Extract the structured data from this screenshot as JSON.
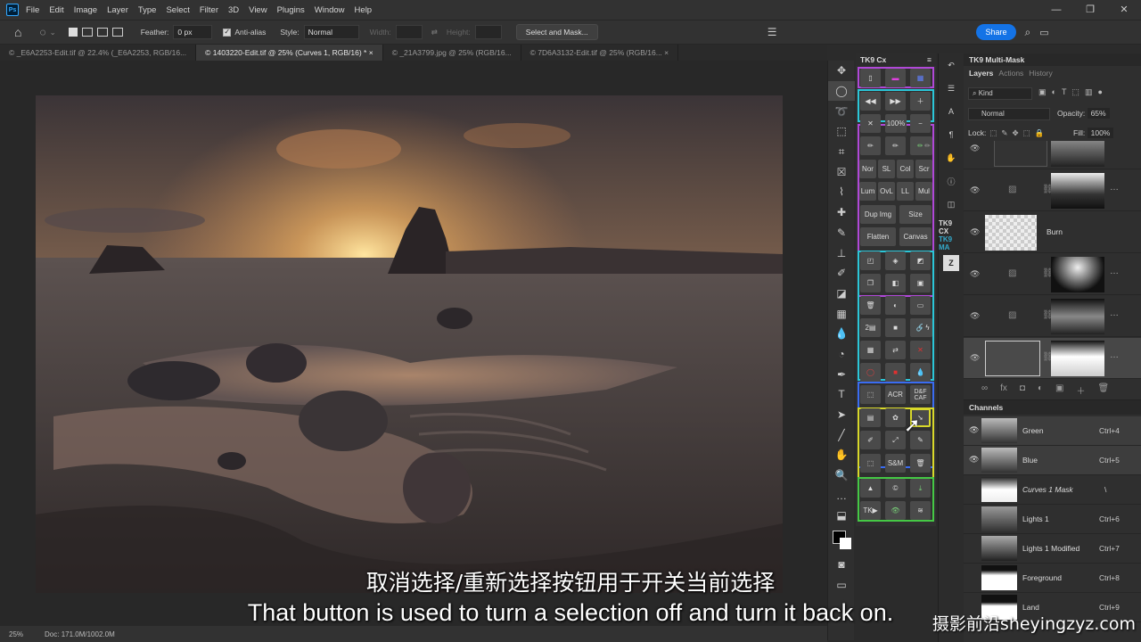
{
  "menu": [
    "File",
    "Edit",
    "Image",
    "Layer",
    "Type",
    "Select",
    "Filter",
    "3D",
    "View",
    "Plugins",
    "Window",
    "Help"
  ],
  "app_icon": "Ps",
  "window_controls": [
    "—",
    "❐",
    "✕"
  ],
  "options": {
    "feather_label": "Feather:",
    "feather_value": "0 px",
    "antialias_label": "Anti-alias",
    "style_label": "Style:",
    "style_value": "Normal",
    "width_label": "Width:",
    "height_label": "Height:",
    "select_mask": "Select and Mask...",
    "share": "Share"
  },
  "tabs": [
    "© _E6A2253-Edit.tif @ 22.4% (_E6A2253, RGB/16...",
    "© 1403220-Edit.tif @ 25% (Curves 1, RGB/16) *  ×",
    "© _21A3799.jpg @ 25% (RGB/16...",
    "© 7D6A3132-Edit.tif @ 25% (RGB/16...  ×"
  ],
  "status": {
    "zoom": "25%",
    "doc": "Doc: 171.0M/1002.0M"
  },
  "tk9": {
    "title": "TK9 Cx",
    "zoom_label": "100%",
    "blend_row1": [
      "Nor",
      "SL",
      "Col",
      "Scr"
    ],
    "blend_row2": [
      "Lum",
      "OvL",
      "LL",
      "Mul"
    ],
    "dup": "Dup Img",
    "size": "Size",
    "flatten": "Flatten",
    "canvas": "Canvas",
    "acr": "ACR",
    "dcaf": "D&F CAF",
    "sm": "S&M",
    "tk": "TK▶"
  },
  "strip_logos": [
    "TK9 CX",
    "TK9 MA"
  ],
  "layers_panel": {
    "title": "TK9 Multi-Mask",
    "tabs": [
      "Layers",
      "Actions",
      "History"
    ],
    "kind": "Kind",
    "blend": "Normal",
    "opacity_label": "Opacity:",
    "opacity": "65%",
    "lock_label": "Lock:",
    "fill_label": "Fill:",
    "fill": "100%",
    "burn": "Burn",
    "bottom_icons": [
      "∞",
      "fx",
      "◘",
      "◐",
      "▣",
      "＋",
      "🗑"
    ]
  },
  "channels": {
    "title": "Channels",
    "rows": [
      {
        "name": "Green",
        "key": "Ctrl+4"
      },
      {
        "name": "Blue",
        "key": "Ctrl+5"
      },
      {
        "name": "Curves 1 Mask",
        "key": "\\"
      },
      {
        "name": "Lights 1",
        "key": "Ctrl+6"
      },
      {
        "name": "Lights 1 Modified",
        "key": "Ctrl+7"
      },
      {
        "name": "Foreground",
        "key": "Ctrl+8"
      },
      {
        "name": "Land",
        "key": "Ctrl+9"
      }
    ]
  },
  "subtitles": {
    "zh": "取消选择/重新选择按钮用于开关当前选择",
    "en": "That button is used to turn a selection off and turn it back on."
  },
  "watermark": "摄影前沿sheyingzyz.com",
  "colors": {
    "share": "#1473e6",
    "group_purple": "#b048d8",
    "group_cyan": "#2bc6d8",
    "group_blue": "#3a6cf2",
    "group_yellow": "#d8d82a",
    "group_green": "#45c845"
  }
}
